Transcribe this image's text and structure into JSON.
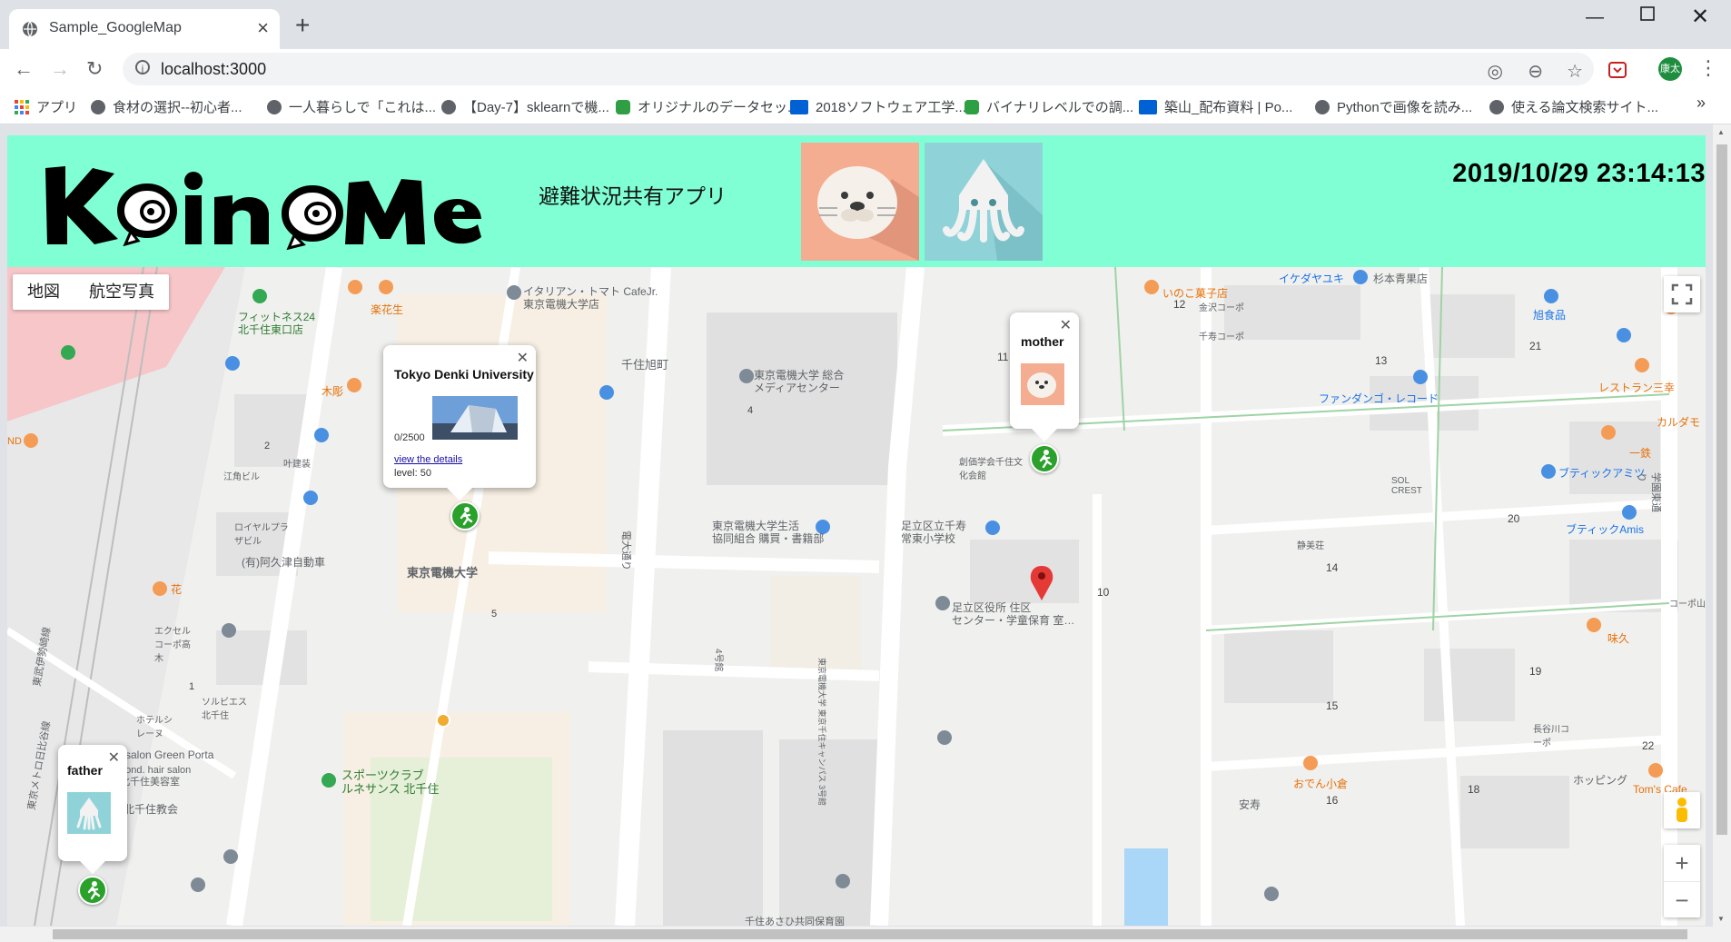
{
  "browser": {
    "tab_title": "Sample_GoogleMap",
    "url": "localhost:3000",
    "profile_label": "康太",
    "bookmarks": [
      {
        "label": "アプリ",
        "color": "#ea4335"
      },
      {
        "label": "食材の選択--初心者...",
        "color": "#5f6368"
      },
      {
        "label": "一人暮らしで「これは...",
        "color": "#5f6368"
      },
      {
        "label": "【Day-7】sklearnで機...",
        "color": "#5f6368"
      },
      {
        "label": "オリジナルのデータセッ...",
        "color": "#2ea043"
      },
      {
        "label": "2018ソフトウェア工学...",
        "color": "#0061d5"
      },
      {
        "label": "バイナリレベルでの調...",
        "color": "#2ea043"
      },
      {
        "label": "築山_配布資料 | Po...",
        "color": "#0061d5"
      },
      {
        "label": "Pythonで画像を読み...",
        "color": "#5f6368"
      },
      {
        "label": "使える論文検索サイト...",
        "color": "#5f6368"
      }
    ]
  },
  "header": {
    "logo_text": "KainoMe",
    "subtitle": "避難状況共有アプリ",
    "datetime": "2019/10/29 23:14:13",
    "bg_color": "#80ffd4",
    "avatars": [
      {
        "name": "seal-avatar",
        "bg": "#f4ad91"
      },
      {
        "name": "squid-avatar",
        "bg": "#8fd3d9"
      }
    ]
  },
  "map": {
    "maptype_buttons": [
      "地図",
      "航空写真"
    ],
    "info_windows": {
      "university": {
        "title": "Tokyo Denki University",
        "count": "0/2500",
        "link": "view the details",
        "level": "level: 50"
      },
      "mother": {
        "title": "mother",
        "avatar": "seal"
      },
      "father": {
        "title": "father",
        "avatar": "squid"
      }
    },
    "labels": [
      "フィットネス24",
      "北千住東口店",
      "イタリアン・トマト CafeJr.",
      "東京電機大学店",
      "千住旭町",
      "東京電機大学 総合",
      "メディアセンター",
      "東京電機大学",
      "東京電機大学生活",
      "協同組合 購買・書籍部",
      "足立区立千寿",
      "常東小学校",
      "足立区役所 住区",
      "センター・学童保育 室…",
      "イケダヤユキ",
      "杉本青果店",
      "いのこ菓子店",
      "金沢コーポ",
      "千寿コーポ",
      "旭食品",
      "レストラン三幸",
      "ファンダンゴ・レコード",
      "カルダモ",
      "一鉄",
      "ブティックアミツ",
      "ブティックAmis",
      "SOL CREST",
      "静美荘",
      "コーポ山",
      "味久",
      "ホッピング",
      "おでん小倉",
      "Tom's Cafe",
      "安寿",
      "長谷川コーポ",
      "創価学会千住文化会館",
      "叶建装",
      "ロイヤルプラザビル",
      "(有)阿久津自動車",
      "江角ビル",
      "木彫",
      "楽花生",
      "花",
      "エクセルコーポ高木",
      "ホテルシレーヌ",
      "ソルビエス北千住",
      "salon Green Porta",
      "bond. hair salon",
      "北千住美容室",
      "北千住教会",
      "スポーツクラブ",
      "ルネサンス 北千住",
      "千住あさひ共同保育園",
      "電大通り",
      "学園東通り",
      "東武伊勢崎線",
      "東京メトロ日比谷線",
      "4号館",
      "東京電機大学 東京千住キャンパス 3号館",
      "ND",
      "2",
      "4",
      "5",
      "10",
      "11",
      "12",
      "13",
      "14",
      "15",
      "16",
      "18",
      "19",
      "20",
      "21",
      "22",
      "1"
    ]
  }
}
